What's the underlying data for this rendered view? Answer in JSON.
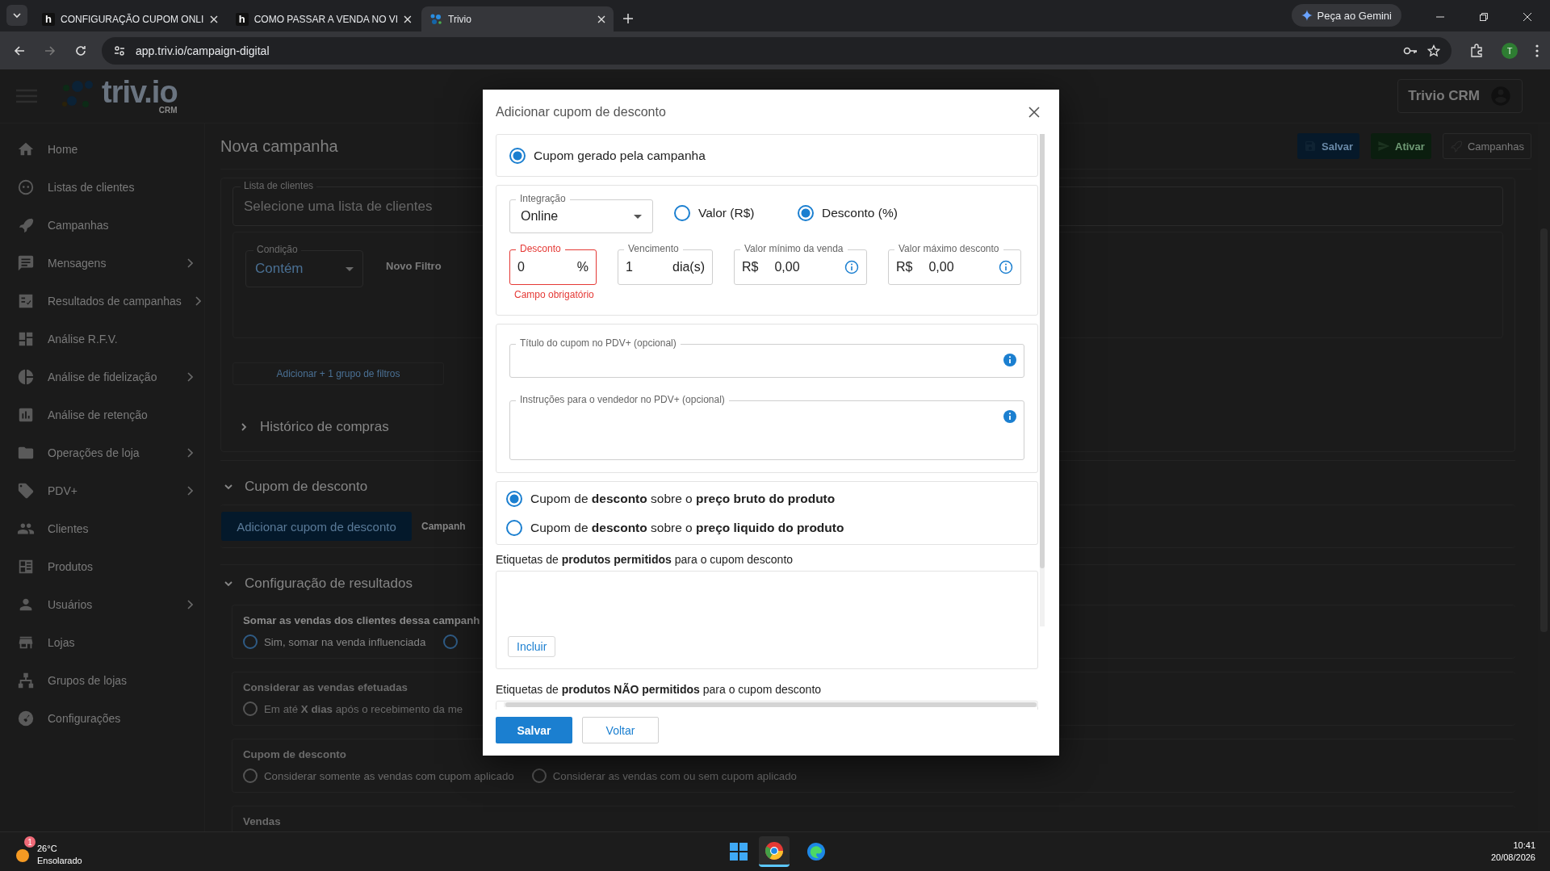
{
  "browser": {
    "tabs": [
      {
        "title": "CONFIGURAÇÃO CUPOM ONLI",
        "favicon_letter": "h",
        "selected": false
      },
      {
        "title": "COMO PASSAR A VENDA NO VI",
        "favicon_letter": "h",
        "selected": false
      },
      {
        "title": "Trivio",
        "selected": true
      }
    ],
    "gemini_button": "Peça ao Gemini",
    "url": "app.triv.io/campaign-digital",
    "profile_initial": "T"
  },
  "header": {
    "logo": "triv.io",
    "logo_sub": "CRM",
    "user": "Trivio CRM"
  },
  "sidebar": {
    "items": [
      {
        "label": "Home",
        "expandable": false
      },
      {
        "label": "Listas de clientes",
        "expandable": false
      },
      {
        "label": "Campanhas",
        "expandable": false
      },
      {
        "label": "Mensagens",
        "expandable": true
      },
      {
        "label": "Resultados de campanhas",
        "expandable": true
      },
      {
        "label": "Análise R.F.V.",
        "expandable": false
      },
      {
        "label": "Análise de fidelização",
        "expandable": true
      },
      {
        "label": "Análise de retenção",
        "expandable": false
      },
      {
        "label": "Operações de loja",
        "expandable": true
      },
      {
        "label": "PDV+",
        "expandable": true
      },
      {
        "label": "Clientes",
        "expandable": false
      },
      {
        "label": "Produtos",
        "expandable": false
      },
      {
        "label": "Usuários",
        "expandable": true
      },
      {
        "label": "Lojas",
        "expandable": false
      },
      {
        "label": "Grupos de lojas",
        "expandable": false
      },
      {
        "label": "Configurações",
        "expandable": false
      }
    ]
  },
  "page": {
    "title": "Nova campanha",
    "toolbar": [
      {
        "label": "Salvar",
        "kind": "save"
      },
      {
        "label": "Ativar",
        "kind": "activate"
      },
      {
        "label": "Campanhas",
        "kind": "campaigns"
      }
    ],
    "client_list": {
      "label": "Lista de clientes",
      "placeholder": "Selecione uma lista de clientes"
    },
    "condition": {
      "label": "Condição",
      "value": "Contém"
    },
    "new_filter": "Novo Filtro",
    "add_group": "Adicionar + 1 grupo de filtros",
    "purchase_history": {
      "label": "Histórico de compras",
      "expanded": false
    },
    "coupon_section": {
      "label": "Cupom de desconto",
      "expanded": true,
      "button": "Adicionar cupom de desconto",
      "tab": "Campanh"
    },
    "results_section": {
      "label": "Configuração de resultados",
      "expanded": true,
      "groups": [
        {
          "title": "Somar as vendas dos clientes dessa campanh",
          "options": [
            {
              "label": "Sim, somar na venda influenciada",
              "selected": false
            },
            {
              "selected": false
            }
          ]
        },
        {
          "title": "Considerar as vendas efetuadas",
          "options": [
            {
              "label": "Em até **X dias** após o recebimento da me",
              "selected": false
            }
          ]
        },
        {
          "title": "Cupom de desconto",
          "options": [
            {
              "label": "Considerar somente as vendas com cupom aplicado",
              "selected": false
            },
            {
              "label": "Considerar as vendas com ou sem cupom aplicado",
              "selected": false
            }
          ]
        },
        {
          "title": "Vendas"
        }
      ]
    }
  },
  "modal": {
    "title": "Adicionar cupom de desconto",
    "coupon_source": {
      "label": "Cupom gerado pela campanha",
      "selected": true
    },
    "integration": {
      "label": "Integração",
      "value": "Online"
    },
    "discount_types": [
      {
        "label": "Valor (R$)",
        "selected": false
      },
      {
        "label": "Desconto (%)",
        "selected": true
      }
    ],
    "fields": [
      {
        "label": "Desconto",
        "value": "0",
        "suffix": "%",
        "invalid": true,
        "error": "Campo obrigatório",
        "info": false
      },
      {
        "label": "Vencimento",
        "value": "1",
        "suffix": "dia(s)",
        "invalid": false,
        "info": false
      },
      {
        "label": "Valor mínimo da venda",
        "prefix": "R$",
        "value": "0,00",
        "invalid": false,
        "info": true
      },
      {
        "label": "Valor máximo desconto",
        "prefix": "R$",
        "value": "0,00",
        "invalid": false,
        "info": true
      }
    ],
    "text_fields": [
      {
        "label": "Título do cupom no PDV+ (opcional)",
        "multiline": false
      },
      {
        "label": "Instruções para o vendedor no PDV+ (opcional)",
        "multiline": true
      }
    ],
    "price_basis": [
      {
        "label": "Cupom de **desconto** sobre o **preço bruto do produto**",
        "selected": true
      },
      {
        "label": "Cupom de **desconto** sobre o **preço liquido do produto**",
        "selected": false
      }
    ],
    "allowed_tags": {
      "label": "Etiquetas de **produtos permitidos** para o cupom desconto",
      "button": "Incluir"
    },
    "blocked_tags": {
      "label": "Etiquetas de **produtos NÃO permitidos** para o cupom desconto"
    },
    "buttons": [
      {
        "label": "Salvar",
        "kind": "primary"
      },
      {
        "label": "Voltar",
        "kind": "secondary"
      }
    ]
  },
  "taskbar": {
    "temperature": "26°C",
    "weather": "Ensolarado",
    "badge": "1",
    "time": "10:41",
    "date": "20/08/2026"
  }
}
